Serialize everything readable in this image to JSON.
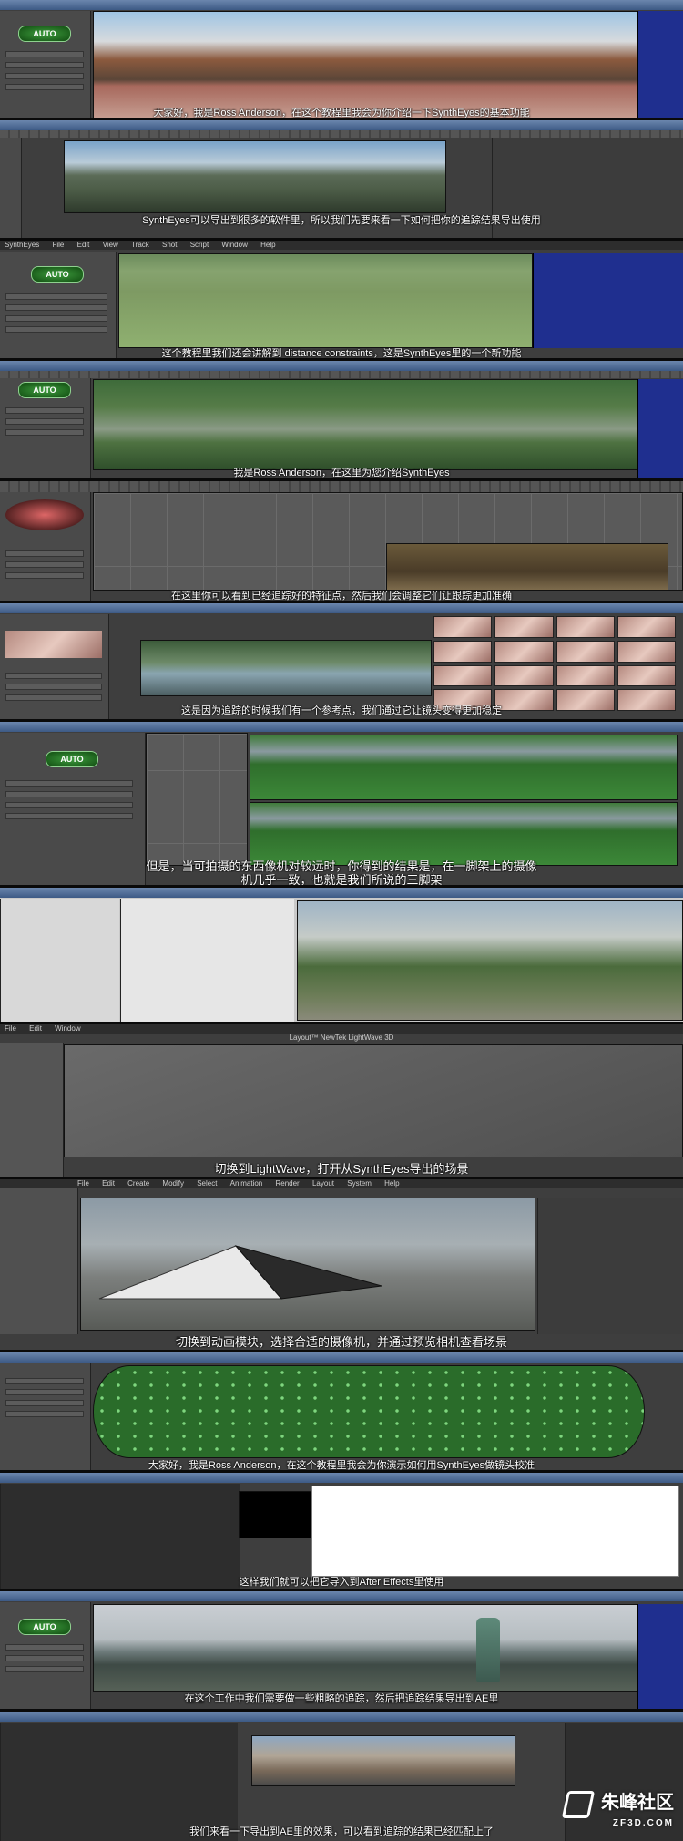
{
  "menu": {
    "syntheyes": [
      "SynthEyes",
      "File",
      "Edit",
      "View",
      "Track",
      "Shot",
      "Script",
      "Window",
      "Help"
    ],
    "lightwave": [
      "File",
      "Edit",
      "Window"
    ],
    "modeler": [
      "File",
      "Edit",
      "Create",
      "Modify",
      "Select",
      "Animation",
      "Render",
      "Layout",
      "System",
      "Help"
    ]
  },
  "panels": {
    "auto_label": "AUTO"
  },
  "titles": {
    "layout": "Layout™ NewTek LightWave 3D"
  },
  "subtitles": {
    "s1": "大家好，我是Ross Anderson，在这个教程里我会为你介绍一下SynthEyes的基本功能",
    "s2": "SynthEyes可以导出到很多的软件里，所以我们先要来看一下如何把你的追踪结果导出使用",
    "s3": "这个教程里我们还会讲解到 distance constraints，这是SynthEyes里的一个新功能",
    "s4": "我是Ross Anderson，在这里为您介绍SynthEyes",
    "s5": "在这里你可以看到已经追踪好的特征点，然后我们会调整它们让跟踪更加准确",
    "s6": "这是因为追踪的时候我们有一个参考点，我们通过它让镜头变得更加稳定",
    "s7a": "但是，当可拍摄的东西像机对较远时，你得到的结果是，在一脚架上的摄像",
    "s7b": "机几乎一致，也就是我们所说的三脚架",
    "s8": "切换到LightWave，打开从SynthEyes导出的场景",
    "s9": "切换到动画模块，选择合适的摄像机，并通过预览相机查看场景",
    "s10": "大家好，我是Ross Anderson，在这个教程里我会为你演示如何用SynthEyes做镜头校准",
    "s11": "这样我们就可以把它导入到After Effects里使用",
    "s12": "在这个工作中我们需要做一些粗略的追踪，然后把追踪结果导出到AE里",
    "s13": "我们来看一下导出到AE里的效果，可以看到追踪的结果已经匹配上了"
  },
  "watermark": {
    "brand": "朱峰社区",
    "url": "ZF3D.COM"
  },
  "colors": {
    "accent_green": "#2fae2f",
    "panel_blue": "#1f2f8f",
    "app_gray": "#3e3e3e"
  }
}
